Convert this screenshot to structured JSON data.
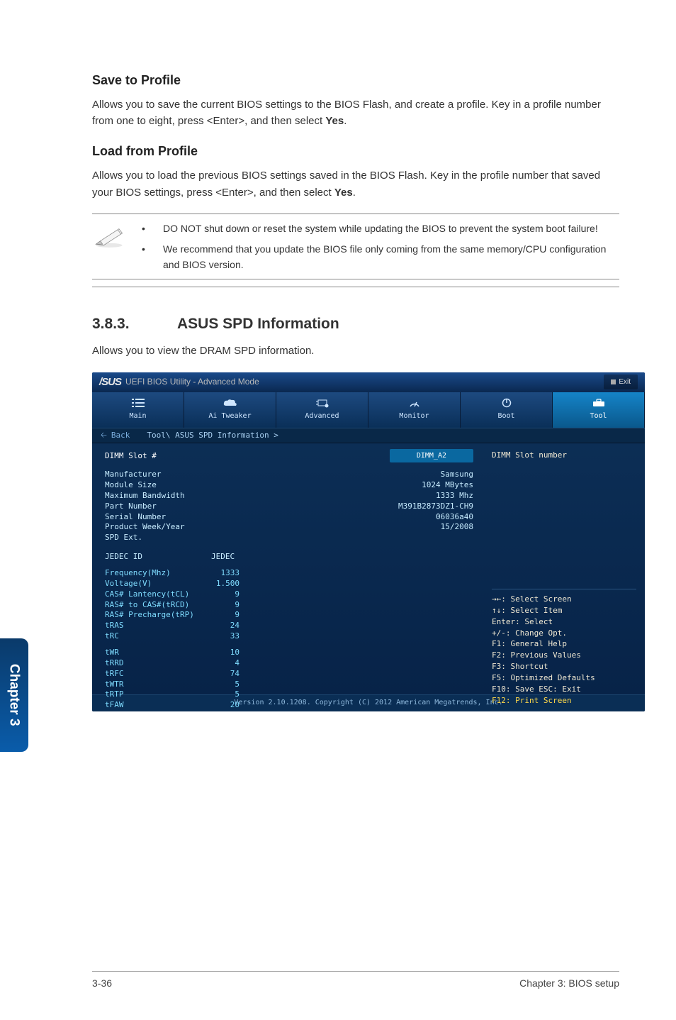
{
  "section_save": {
    "title": "Save to Profile",
    "body": "Allows you to save the current BIOS settings to the BIOS Flash, and create a profile. Key in a profile number from one to eight, press <Enter>, and then select ",
    "bold_tail": "Yes",
    "tail_period": "."
  },
  "section_load": {
    "title": "Load from Profile",
    "body": "Allows you to load the previous BIOS settings saved in the BIOS Flash. Key in the profile number that saved your BIOS settings, press <Enter>, and then select ",
    "bold_tail": "Yes",
    "tail_period": "."
  },
  "notes": {
    "n1": "DO NOT shut down or reset the system while updating the BIOS to prevent the system boot failure!",
    "n2": "We recommend that you update the BIOS file only coming from the same memory/CPU configuration and BIOS version."
  },
  "section_spd": {
    "number": "3.8.3.",
    "title": "ASUS SPD Information",
    "body": "Allows you to view the DRAM SPD information."
  },
  "bios": {
    "brand": "/SUS",
    "header_text": "UEFI BIOS Utility - Advanced Mode",
    "exit_label": "Exit",
    "tabs": {
      "main": "Main",
      "tweaker": "Ai Tweaker",
      "advanced": "Advanced",
      "monitor": "Monitor",
      "boot": "Boot",
      "tool": "Tool"
    },
    "crumb_back": "Back",
    "crumb_path": "Tool\\ ASUS SPD Information >",
    "dimm_slot_label": "DIMM Slot #",
    "dimm_slot_value": "DIMM_A2",
    "right_caption": "DIMM Slot number",
    "info": {
      "Manufacturer": "Samsung",
      "Module Size": "1024 MBytes",
      "Maximum Bandwidth": "1333 Mhz",
      "Part Number": "M391B2873DZ1-CH9",
      "Serial Number": "06036a40",
      "Product Week/Year": "15/2008",
      "SPD Ext.": ""
    },
    "jedec_id_label": "JEDEC ID",
    "jedec_id_value": "JEDEC",
    "timings": {
      "Frequency(Mhz)": "1333",
      "Voltage(V)": "1.500",
      "CAS# Lantency(tCL)": "9",
      "RAS# to CAS#(tRCD)": "9",
      "RAS# Precharge(tRP)": "9",
      "tRAS": "24",
      "tRC": "33",
      "tWR": "10",
      "tRRD": "4",
      "tRFC": "74",
      "tWTR": "5",
      "tRTP": "5",
      "tFAW": "20"
    },
    "help": {
      "h1": "→←: Select Screen",
      "h2": "↑↓: Select Item",
      "h3": "Enter: Select",
      "h4": "+/-: Change Opt.",
      "h5": "F1: General Help",
      "h6": "F2: Previous Values",
      "h7": "F3: Shortcut",
      "h8": "F5: Optimized Defaults",
      "h9": "F10: Save  ESC: Exit",
      "h10": "F12: Print Screen"
    },
    "footer": "Version 2.10.1208. Copyright (C) 2012 American Megatrends, Inc."
  },
  "side_tab": "Chapter 3",
  "page_footer": {
    "left": "3-36",
    "right": "Chapter 3: BIOS setup"
  },
  "bullet": "•"
}
